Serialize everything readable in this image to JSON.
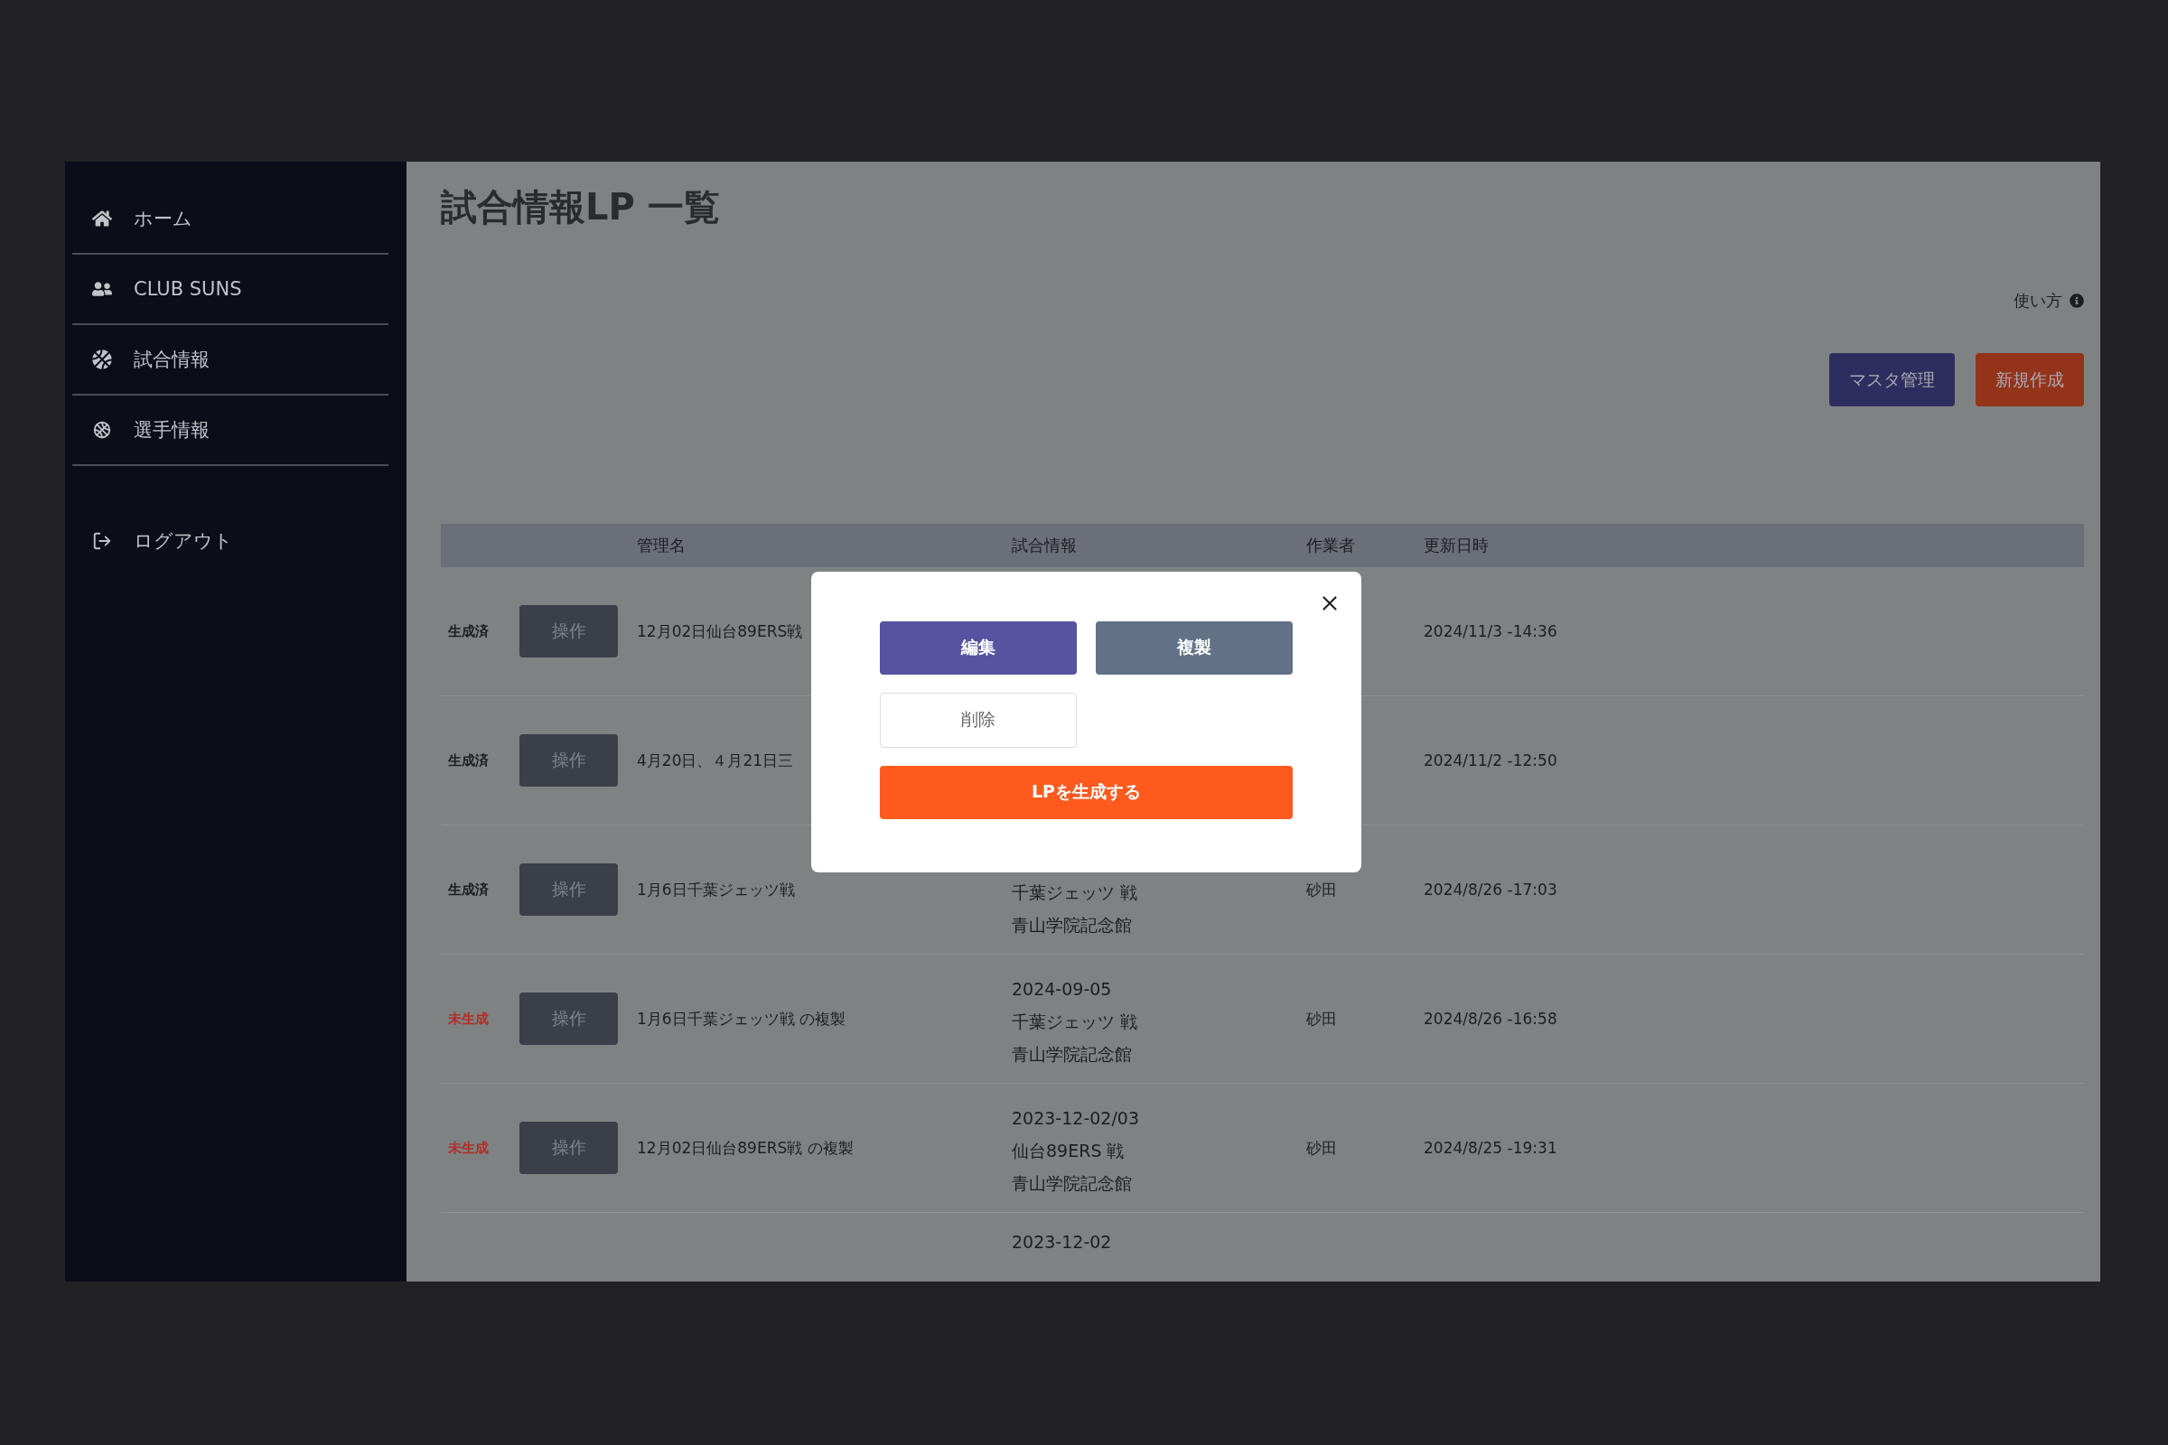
{
  "sidebar": {
    "items": [
      {
        "label": "ホーム"
      },
      {
        "label": "CLUB SUNS"
      },
      {
        "label": "試合情報"
      },
      {
        "label": "選手情報"
      }
    ],
    "logout": "ログアウト"
  },
  "page": {
    "title": "試合情報LP 一覧",
    "help": "使い方",
    "buttons": [
      {
        "label": "マスタ管理",
        "kind": "master"
      },
      {
        "label": "新規作成",
        "kind": "create"
      }
    ]
  },
  "table": {
    "columns": [
      "管理名",
      "試合情報",
      "作業者",
      "更新日時"
    ],
    "rows": [
      {
        "status": {
          "label": "生成済",
          "color": "#1c1d20"
        },
        "action": "操作",
        "name": "12月02日仙台89ERS戦",
        "match_info": [],
        "author": "",
        "updated": "2024/11/3 -14:36"
      },
      {
        "status": {
          "label": "生成済",
          "color": "#1c1d20"
        },
        "action": "操作",
        "name": "4月20日、４月21日三",
        "match_info": [],
        "author": "",
        "updated": "2024/11/2 -12:50"
      },
      {
        "status": {
          "label": "生成済",
          "color": "#1c1d20"
        },
        "action": "操作",
        "name": "1月6日千葉ジェッツ戦",
        "match_info": [
          "千葉ジェッツ 戦",
          "青山学院記念館"
        ],
        "author": "砂田",
        "updated": "2024/8/26 -17:03"
      },
      {
        "status": {
          "label": "未生成",
          "color": "#b52b27"
        },
        "action": "操作",
        "name": "1月6日千葉ジェッツ戦 の複製",
        "match_info": [
          "2024-09-05",
          "千葉ジェッツ 戦",
          "青山学院記念館"
        ],
        "author": "砂田",
        "updated": "2024/8/26 -16:58"
      },
      {
        "status": {
          "label": "未生成",
          "color": "#b52b27"
        },
        "action": "操作",
        "name": "12月02日仙台89ERS戦 の複製",
        "match_info": [
          "2023-12-02/03",
          "仙台89ERS 戦",
          "青山学院記念館"
        ],
        "author": "砂田",
        "updated": "2024/8/25 -19:31"
      },
      {
        "match_info": [
          "2023-12-02"
        ]
      }
    ]
  },
  "modal": {
    "buttons": [
      {
        "label": "編集",
        "kind": "edit"
      },
      {
        "label": "複製",
        "kind": "copy"
      },
      {
        "label": "削除",
        "kind": "delete"
      },
      {
        "label": "LPを生成する",
        "kind": "generate"
      }
    ]
  }
}
